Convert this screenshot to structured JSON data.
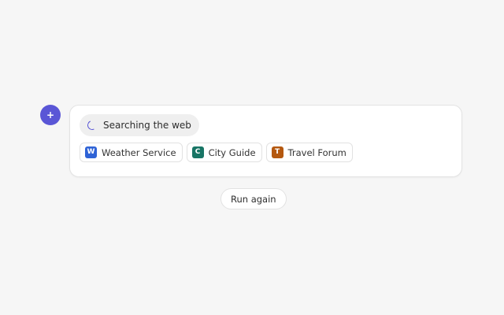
{
  "assistant": {
    "avatar_glyph": "+",
    "avatar_color": "#5a56d6"
  },
  "status": {
    "label": "Searching the web",
    "icon": "spinner-icon"
  },
  "sources": [
    {
      "letter": "W",
      "label": "Weather Service",
      "color": "#2f63d6"
    },
    {
      "letter": "C",
      "label": "City Guide",
      "color": "#187565"
    },
    {
      "letter": "T",
      "label": "Travel Forum",
      "color": "#b4580f"
    }
  ],
  "actions": {
    "run_again_label": "Run again"
  }
}
